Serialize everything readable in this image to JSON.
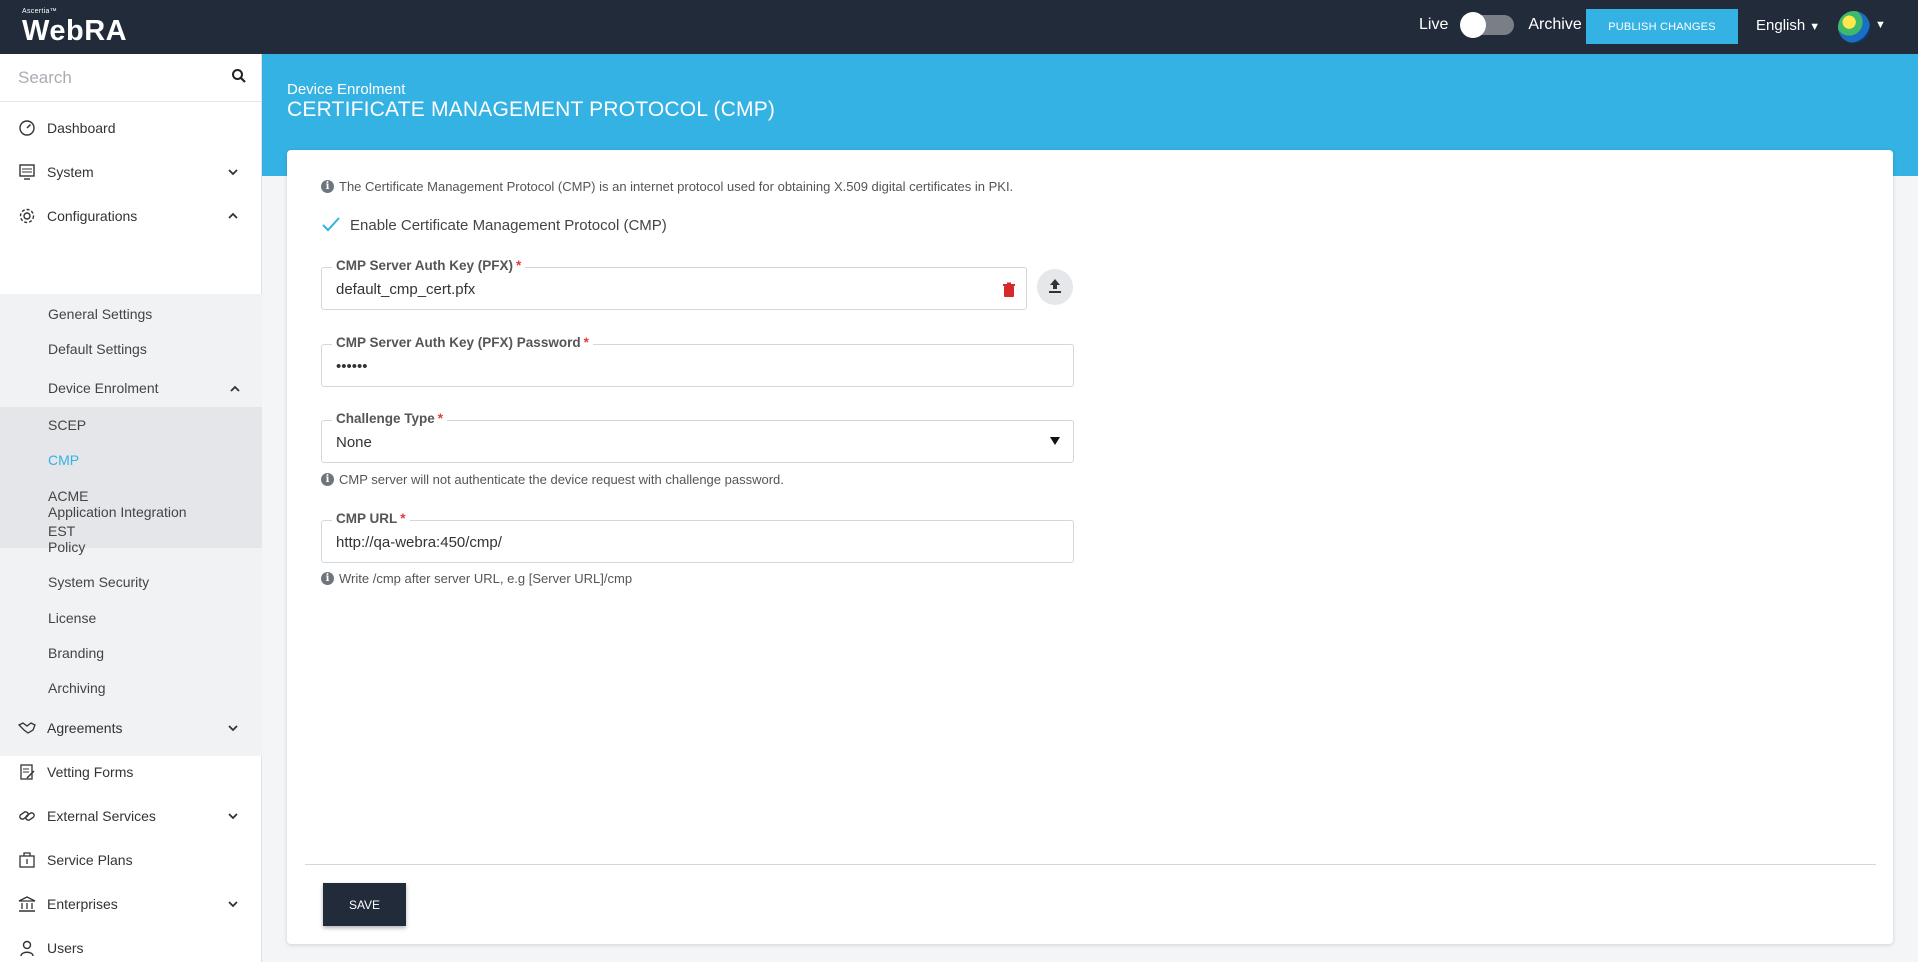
{
  "header": {
    "brand_small": "Ascertia™",
    "brand": "WebRA",
    "live_label": "Live",
    "archive_label": "Archive",
    "publish_label": "PUBLISH CHANGES",
    "language": "English",
    "colors": {
      "topbar": "#222b3a",
      "accent": "#34b2e4"
    }
  },
  "sidebar": {
    "search_placeholder": "Search",
    "items": {
      "dashboard": "Dashboard",
      "system": "System",
      "configurations": "Configurations",
      "agreements": "Agreements",
      "vetting_forms": "Vetting Forms",
      "external_services": "External Services",
      "service_plans": "Service Plans",
      "enterprises": "Enterprises",
      "users": "Users"
    },
    "config_sub": {
      "general_settings": "General Settings",
      "default_settings": "Default Settings",
      "device_enrolment": "Device Enrolment",
      "application_integration": "Application Integration",
      "policy": "Policy",
      "system_security": "System Security",
      "license": "License",
      "branding": "Branding",
      "archiving": "Archiving"
    },
    "device_enrolment_sub": {
      "scep": "SCEP",
      "cmp": "CMP",
      "acme": "ACME",
      "est": "EST"
    },
    "active_item": "CMP"
  },
  "page": {
    "breadcrumb": "Device Enrolment",
    "title": "CERTIFICATE MANAGEMENT PROTOCOL (CMP)",
    "intro": "The Certificate Management Protocol (CMP) is an internet protocol used for obtaining X.509 digital certificates in PKI.",
    "enable_label": "Enable Certificate Management Protocol (CMP)",
    "enable_checked": true,
    "fields": {
      "auth_key": {
        "label": "CMP Server Auth Key (PFX)",
        "required": "*",
        "value": "default_cmp_cert.pfx"
      },
      "auth_password": {
        "label": "CMP Server Auth Key (PFX) Password",
        "required": "*",
        "value": "••••••"
      },
      "challenge_type": {
        "label": "Challenge Type",
        "required": "*",
        "value": "None",
        "hint": "CMP server will not authenticate the device request with challenge password."
      },
      "cmp_url": {
        "label": "CMP URL",
        "required": "*",
        "value": "http://qa-webra:450/cmp/",
        "hint": "Write /cmp after server URL, e.g [Server URL]/cmp"
      }
    },
    "save_label": "SAVE"
  }
}
